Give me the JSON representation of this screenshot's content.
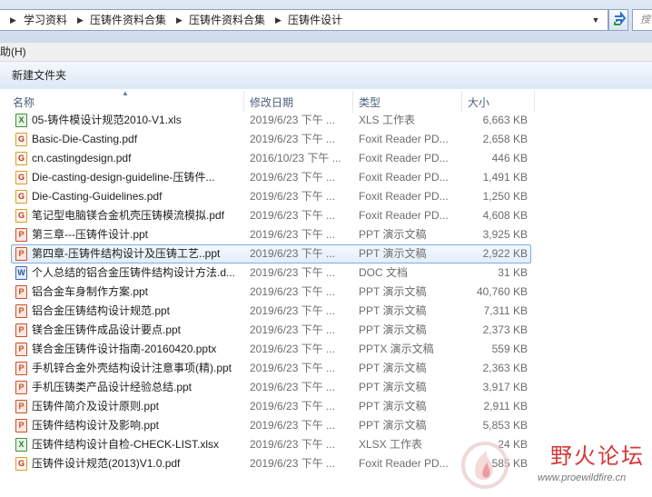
{
  "address": {
    "crumbs": [
      "学习资料",
      "压铸件资料合集",
      "压铸件资料合集",
      "压铸件设计"
    ],
    "search_placeholder": "搜"
  },
  "menu": {
    "items": [
      "助(H)"
    ]
  },
  "toolbar": {
    "new_folder": "新建文件夹"
  },
  "columns": {
    "name": "名称",
    "date": "修改日期",
    "type": "类型",
    "size": "大小"
  },
  "files": [
    {
      "name": "05-铸件模设计规范2010-V1.xls",
      "date": "2019/6/23 下午 ...",
      "type": "XLS 工作表",
      "size": "6,663 KB",
      "icon": "excel-icon",
      "kind": "xls",
      "glyph": "X"
    },
    {
      "name": "Basic-Die-Casting.pdf",
      "date": "2019/6/23 下午 ...",
      "type": "Foxit Reader PD...",
      "size": "2,658 KB",
      "icon": "pdf-icon",
      "kind": "pdf",
      "glyph": "G"
    },
    {
      "name": "cn.castingdesign.pdf",
      "date": "2016/10/23 下午 ...",
      "type": "Foxit Reader PD...",
      "size": "446 KB",
      "icon": "pdf-icon",
      "kind": "pdf",
      "glyph": "G"
    },
    {
      "name": "Die-casting-design-guideline-压铸件...",
      "date": "2019/6/23 下午 ...",
      "type": "Foxit Reader PD...",
      "size": "1,491 KB",
      "icon": "pdf-icon",
      "kind": "pdf",
      "glyph": "G"
    },
    {
      "name": "Die-Casting-Guidelines.pdf",
      "date": "2019/6/23 下午 ...",
      "type": "Foxit Reader PD...",
      "size": "1,250 KB",
      "icon": "pdf-icon",
      "kind": "pdf",
      "glyph": "G"
    },
    {
      "name": "笔记型电脑镁合金机壳压铸模流模拟.pdf",
      "date": "2019/6/23 下午 ...",
      "type": "Foxit Reader PD...",
      "size": "4,608 KB",
      "icon": "pdf-icon",
      "kind": "pdf",
      "glyph": "G"
    },
    {
      "name": "第三章---压铸件设计.ppt",
      "date": "2019/6/23 下午 ...",
      "type": "PPT 演示文稿",
      "size": "3,925 KB",
      "icon": "powerpoint-icon",
      "kind": "ppt",
      "glyph": "P"
    },
    {
      "name": "第四章-压铸件结构设计及压铸工艺..ppt",
      "date": "2019/6/23 下午 ...",
      "type": "PPT 演示文稿",
      "size": "2,922 KB",
      "icon": "powerpoint-icon",
      "kind": "ppt",
      "glyph": "P",
      "selected": true
    },
    {
      "name": "个人总结的铝合金压铸件结构设计方法.d...",
      "date": "2019/6/23 下午 ...",
      "type": "DOC 文档",
      "size": "31 KB",
      "icon": "word-icon",
      "kind": "doc",
      "glyph": "W"
    },
    {
      "name": "铝合金车身制作方案.ppt",
      "date": "2019/6/23 下午 ...",
      "type": "PPT 演示文稿",
      "size": "40,760 KB",
      "icon": "powerpoint-icon",
      "kind": "ppt",
      "glyph": "P"
    },
    {
      "name": "铝合金压铸结构设计规范.ppt",
      "date": "2019/6/23 下午 ...",
      "type": "PPT 演示文稿",
      "size": "7,311 KB",
      "icon": "powerpoint-icon",
      "kind": "ppt",
      "glyph": "P"
    },
    {
      "name": "镁合金压铸件成品设计要点.ppt",
      "date": "2019/6/23 下午 ...",
      "type": "PPT 演示文稿",
      "size": "2,373 KB",
      "icon": "powerpoint-icon",
      "kind": "ppt",
      "glyph": "P"
    },
    {
      "name": "镁合金压铸件设计指南-20160420.pptx",
      "date": "2019/6/23 下午 ...",
      "type": "PPTX 演示文稿",
      "size": "559 KB",
      "icon": "powerpoint-icon",
      "kind": "ppt",
      "glyph": "P"
    },
    {
      "name": "手机锌合金外壳结构设计注意事项(精).ppt",
      "date": "2019/6/23 下午 ...",
      "type": "PPT 演示文稿",
      "size": "2,363 KB",
      "icon": "powerpoint-icon",
      "kind": "ppt",
      "glyph": "P"
    },
    {
      "name": "手机压铸类产品设计经验总结.ppt",
      "date": "2019/6/23 下午 ...",
      "type": "PPT 演示文稿",
      "size": "3,917 KB",
      "icon": "powerpoint-icon",
      "kind": "ppt",
      "glyph": "P"
    },
    {
      "name": "压铸件简介及设计原则.ppt",
      "date": "2019/6/23 下午 ...",
      "type": "PPT 演示文稿",
      "size": "2,911 KB",
      "icon": "powerpoint-icon",
      "kind": "ppt",
      "glyph": "P"
    },
    {
      "name": "压铸件结构设计及影响.ppt",
      "date": "2019/6/23 下午 ...",
      "type": "PPT 演示文稿",
      "size": "5,853 KB",
      "icon": "powerpoint-icon",
      "kind": "ppt",
      "glyph": "P"
    },
    {
      "name": "压铸件结构设计自检-CHECK-LIST.xlsx",
      "date": "2019/6/23 下午 ...",
      "type": "XLSX 工作表",
      "size": "24 KB",
      "icon": "excel-icon",
      "kind": "xls",
      "glyph": "X"
    },
    {
      "name": "压铸件设计规范(2013)V1.0.pdf",
      "date": "2019/6/23 下午 ...",
      "type": "Foxit Reader PD...",
      "size": "585 KB",
      "icon": "pdf-icon",
      "kind": "pdf",
      "glyph": "G"
    }
  ],
  "watermark": {
    "title": "野火论坛",
    "url": "www.proewildfire.cn"
  }
}
